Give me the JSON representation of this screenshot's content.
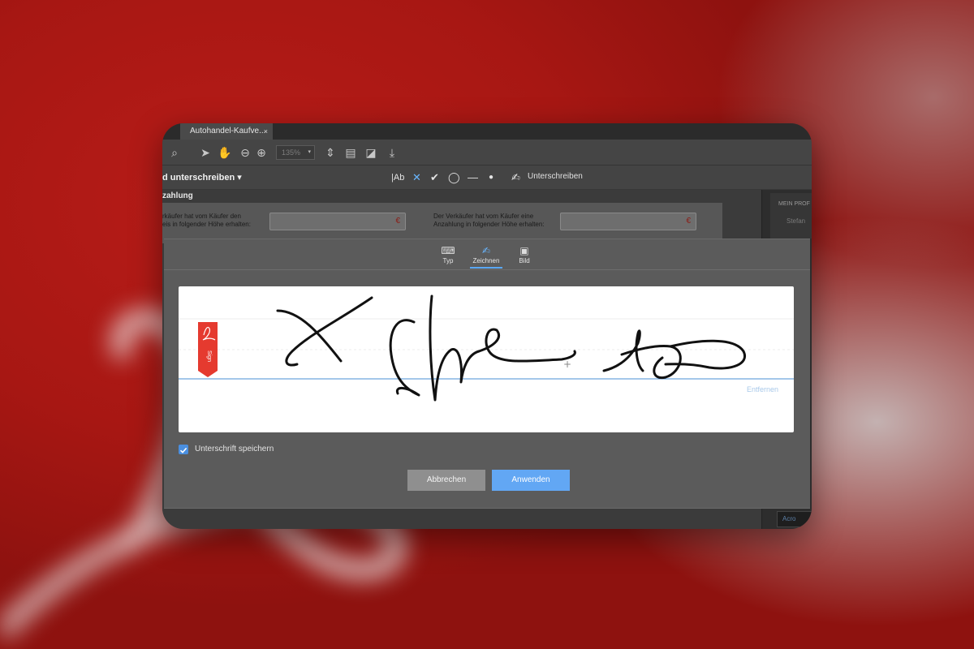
{
  "tab": {
    "title": "Autohandel-Kaufve...",
    "close": "×"
  },
  "toolbar": {
    "zoom_value": "135%",
    "zoom_caret": "▾"
  },
  "fill_sign": {
    "label": "d unterschreiben ▾",
    "sign_label": "Unterschreiben",
    "text_tool": "|Ab"
  },
  "document": {
    "section_title": "zahlung",
    "left_line1": "rkäufer hat vom Käufer den",
    "left_line2": "eis in folgender Höhe erhalten:",
    "right_line1": "Der Verkäufer hat vom Käufer eine",
    "right_line2": "Anzahlung in folgender Höhe erhalten:",
    "currency": "€"
  },
  "sidebar": {
    "heading": "MEIN PROF",
    "item": "Stefan",
    "button": "Acro"
  },
  "dialog": {
    "tabs": [
      {
        "label": "Typ"
      },
      {
        "label": "Zeichnen"
      },
      {
        "label": "Bild"
      }
    ],
    "sign_tag": "Sign",
    "remove_label": "Entfernen",
    "save_label": "Unterschrift speichern",
    "save_checked": true,
    "cancel_label": "Abbrechen",
    "apply_label": "Anwenden"
  },
  "colors": {
    "accent": "#5aa8f5",
    "brand_red": "#e53a2f",
    "background_red": "#b01914"
  }
}
